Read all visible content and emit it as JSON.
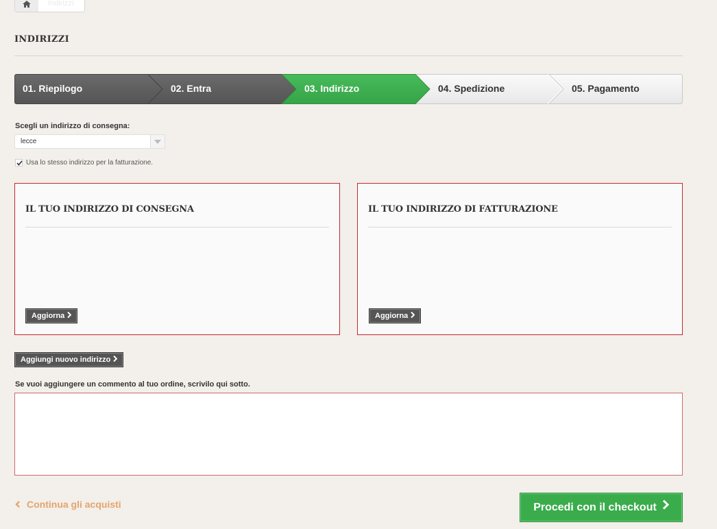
{
  "breadcrumb": {
    "home_icon": "home-icon",
    "current": "Indirizzi"
  },
  "page": {
    "title": "INDIRIZZI"
  },
  "steps": [
    {
      "label": "01. Riepilogo",
      "state": "done"
    },
    {
      "label": "02. Entra",
      "state": "done"
    },
    {
      "label": "03. Indirizzo",
      "state": "active"
    },
    {
      "label": "04. Spedizione",
      "state": "todo"
    },
    {
      "label": "05. Pagamento",
      "state": "todo"
    }
  ],
  "delivery": {
    "label": "Scegli un indirizzo di consegna:",
    "selected": "lecce",
    "same_billing_label": "Usa lo stesso indirizzo per la fatturazione.",
    "same_billing_checked": true
  },
  "boxes": {
    "delivery": {
      "heading": "IL TUO INDIRIZZO DI CONSEGNA",
      "button": "Aggiorna"
    },
    "billing": {
      "heading": "IL TUO INDIRIZZO DI FATTURAZIONE",
      "button": "Aggiorna"
    }
  },
  "add_address": "Aggiungi nuovo indirizzo",
  "comment": {
    "label": "Se vuoi aggiungere un commento al tuo ordine, scrivilo qui sotto.",
    "value": ""
  },
  "footer": {
    "continue": "Continua gli acquisti",
    "checkout": "Procedi con il checkout"
  },
  "colors": {
    "active_step": "#3aac4c",
    "done_step": "#5e5e5e",
    "box_border": "#c0272d",
    "link": "#e3a56c"
  }
}
